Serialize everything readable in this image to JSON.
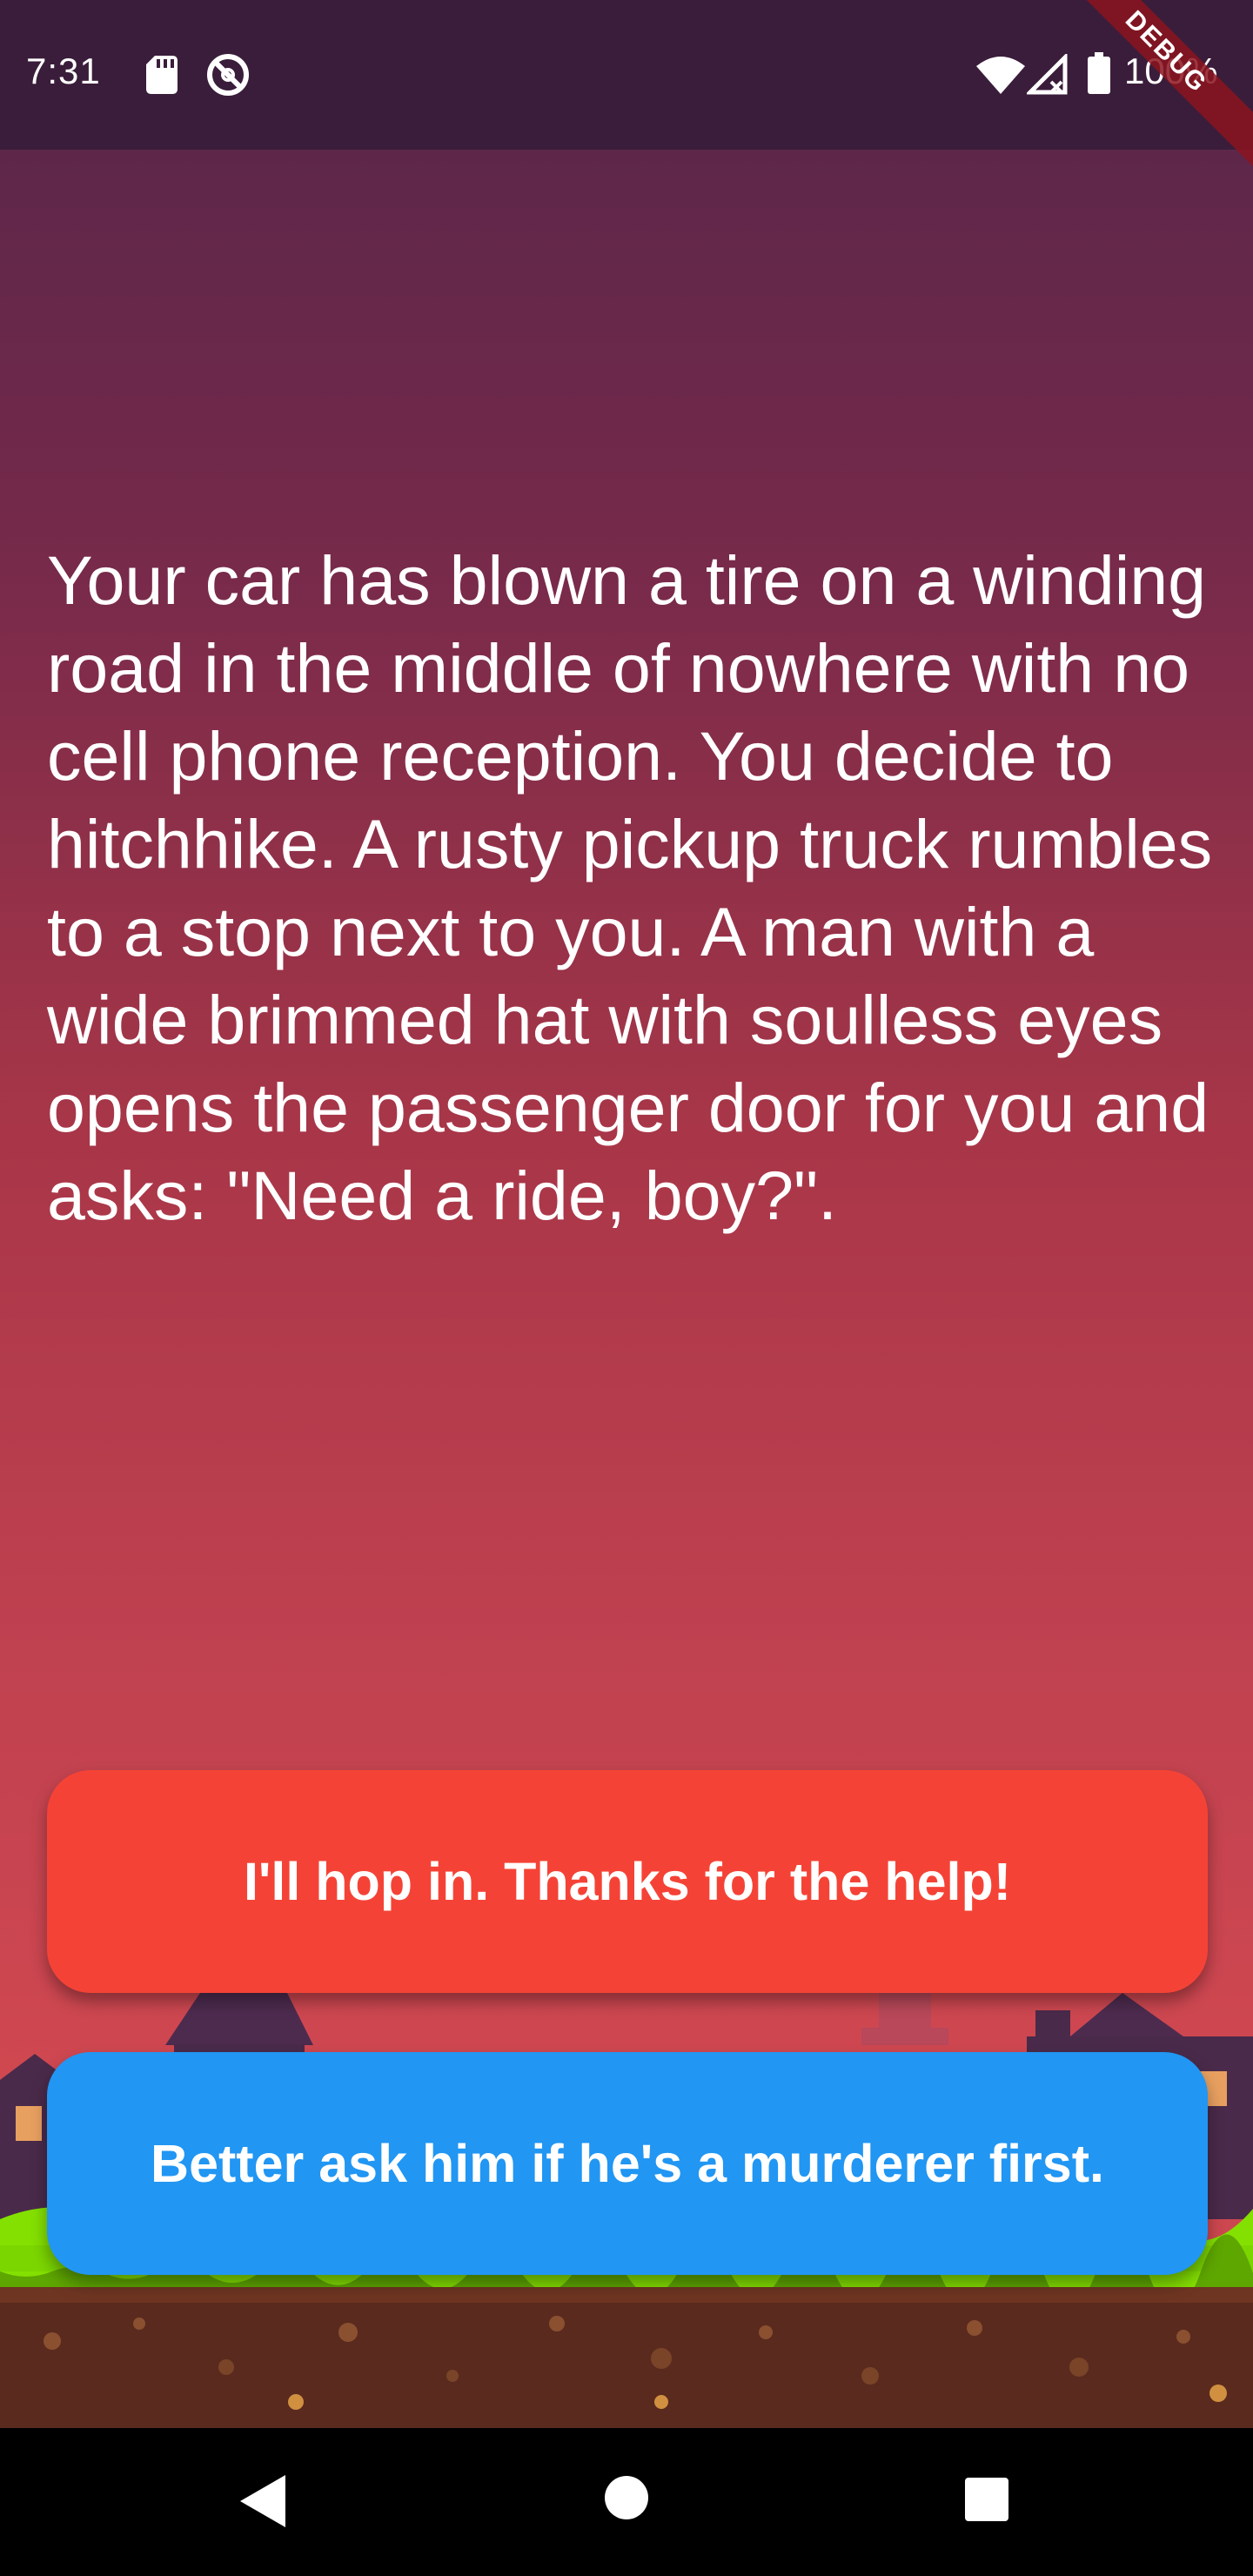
{
  "status_bar": {
    "time": "7:31",
    "battery_percent": "100%",
    "icons": [
      "sd-card-icon",
      "do-not-disturb-icon",
      "wifi-icon",
      "cell-signal-icon",
      "battery-icon"
    ]
  },
  "debug_banner": {
    "label": "DEBUG",
    "color": "#8c141e"
  },
  "story": {
    "text": "Your car has blown a tire on a winding road in the middle of nowhere with no cell phone reception. You decide to hitchhike. A rusty pickup truck rumbles to a stop next to you. A man with a wide brimmed hat with soulless eyes opens the passenger door for you and asks: \"Need a ride, boy?\"."
  },
  "choices": [
    {
      "label": "I'll hop in. Thanks for the help!",
      "color": "#f44336"
    },
    {
      "label": "Better ask him if he's a murderer first.",
      "color": "#2196f3"
    }
  ],
  "nav_bar": {
    "icons": [
      "back-icon",
      "home-icon",
      "recents-icon"
    ]
  }
}
